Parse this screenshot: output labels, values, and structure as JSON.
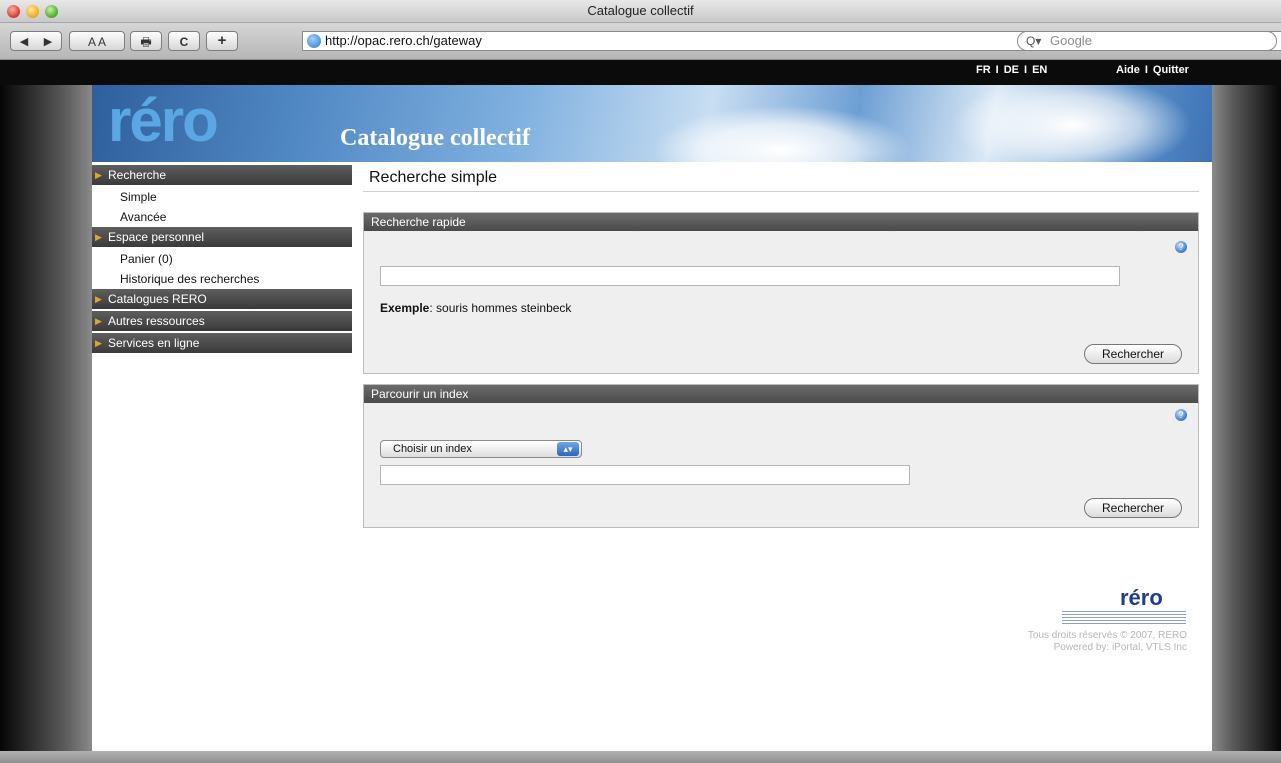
{
  "window": {
    "title": "Catalogue collectif"
  },
  "toolbar": {
    "back_forward": [
      "◀",
      "▶"
    ],
    "text_size": "A A",
    "print": "🖶",
    "reload": "C",
    "add": "+",
    "address": "http://opac.rero.ch/gateway",
    "search_placeholder": "Google",
    "search_icon": "Q▾"
  },
  "topnav": {
    "languages": [
      "FR",
      "DE",
      "EN"
    ],
    "separator": "I",
    "help": "Aide",
    "quit": "Quitter"
  },
  "banner": {
    "logo": "réro",
    "title": "Catalogue collectif"
  },
  "sidebar": {
    "sections": [
      {
        "label": "Recherche",
        "items": [
          "Simple",
          "Avancée"
        ]
      },
      {
        "label": "Espace personnel",
        "items": [
          "Panier (0)",
          "Historique des recherches"
        ]
      },
      {
        "label": "Catalogues RERO",
        "items": []
      },
      {
        "label": "Autres ressources",
        "items": []
      },
      {
        "label": "Services en ligne",
        "items": []
      }
    ]
  },
  "main": {
    "title": "Recherche simple",
    "quick": {
      "heading": "Recherche rapide",
      "query_value": "",
      "example_label": "Exemple",
      "example_text": ": souris hommes steinbeck",
      "button": "Rechercher"
    },
    "browse": {
      "heading": "Parcourir un index",
      "select_value": "Choisir un index",
      "query_value": "",
      "button": "Rechercher"
    }
  },
  "footer": {
    "logo": "réro",
    "copyright": "Tous droits réservés © 2007, RERO",
    "powered": "Powered by: iPortal, VTLS Inc"
  },
  "colors": {
    "nav_section": "#4a4a4a",
    "nav_arrow": "#e3a32a",
    "banner_blue": "#4f87c3",
    "logo_blue": "#5aa8e3"
  }
}
